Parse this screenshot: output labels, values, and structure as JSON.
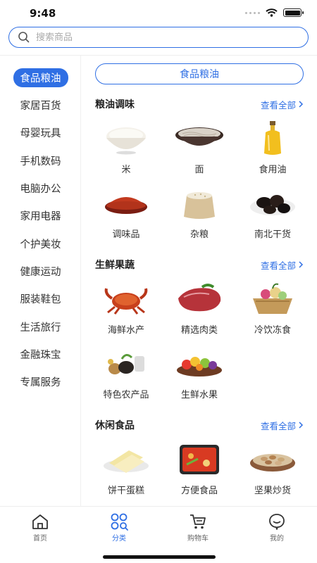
{
  "status_bar": {
    "time": "9:48"
  },
  "search": {
    "placeholder": "搜索商品"
  },
  "sidebar": {
    "items": [
      {
        "label": "食品粮油",
        "active": true
      },
      {
        "label": "家居百货"
      },
      {
        "label": "母婴玩具"
      },
      {
        "label": "手机数码"
      },
      {
        "label": "电脑办公"
      },
      {
        "label": "家用电器"
      },
      {
        "label": "个护美妆"
      },
      {
        "label": "健康运动"
      },
      {
        "label": "服装鞋包"
      },
      {
        "label": "生活旅行"
      },
      {
        "label": "金融珠宝"
      },
      {
        "label": "专属服务"
      }
    ]
  },
  "main": {
    "category_title": "食品粮油",
    "sections": [
      {
        "title": "粮油调味",
        "view_all": "查看全部",
        "products": [
          {
            "label": "米",
            "icon": "rice-bowl-image"
          },
          {
            "label": "面",
            "icon": "noodles-bowl-image"
          },
          {
            "label": "食用油",
            "icon": "oil-bottle-image"
          },
          {
            "label": "调味品",
            "icon": "chili-powder-image"
          },
          {
            "label": "杂粮",
            "icon": "grain-sack-image"
          },
          {
            "label": "南北干货",
            "icon": "dried-goods-image"
          }
        ]
      },
      {
        "title": "生鲜果蔬",
        "view_all": "查看全部",
        "products": [
          {
            "label": "海鲜水产",
            "icon": "crab-image"
          },
          {
            "label": "精选肉类",
            "icon": "meat-image"
          },
          {
            "label": "冷饮冻食",
            "icon": "frozen-food-image"
          },
          {
            "label": "特色农产品",
            "icon": "farm-produce-image"
          },
          {
            "label": "生鲜水果",
            "icon": "fruit-plate-image"
          }
        ]
      },
      {
        "title": "休闲食品",
        "view_all": "查看全部",
        "products": [
          {
            "label": "饼干蛋糕",
            "icon": "cake-image"
          },
          {
            "label": "方便食品",
            "icon": "instant-hotpot-image"
          },
          {
            "label": "坚果炒货",
            "icon": "nuts-image"
          }
        ]
      }
    ]
  },
  "tabbar": {
    "tabs": [
      {
        "label": "首页",
        "icon": "home-icon"
      },
      {
        "label": "分类",
        "icon": "category-icon",
        "active": true
      },
      {
        "label": "购物车",
        "icon": "cart-icon"
      },
      {
        "label": "我的",
        "icon": "profile-icon"
      }
    ]
  },
  "colors": {
    "accent": "#2f6fe4",
    "text": "#333333",
    "muted": "#999999"
  }
}
